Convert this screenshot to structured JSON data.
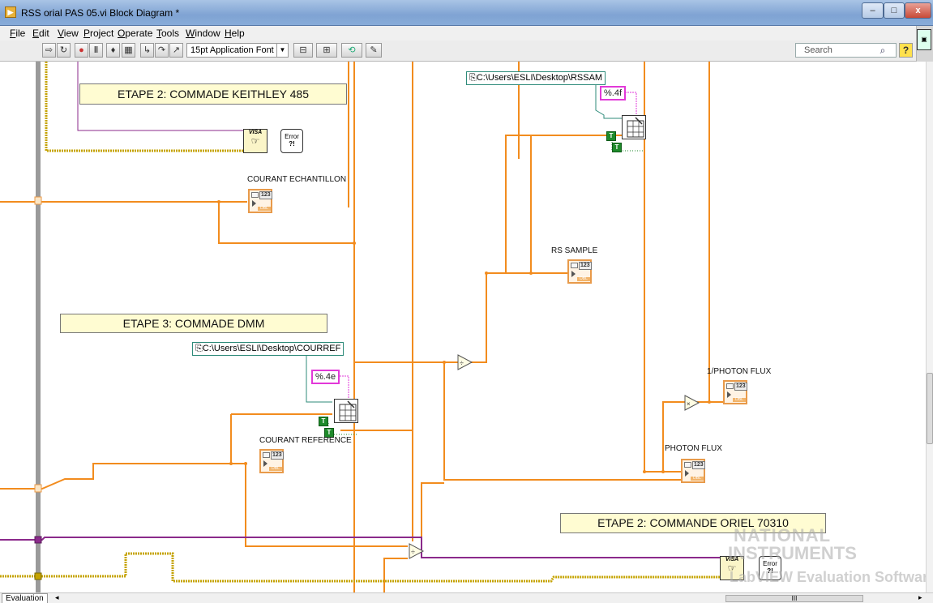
{
  "window": {
    "title": "RSS orial PAS 05.vi Block Diagram *",
    "buttons": {
      "minimize": "–",
      "maximize": "□",
      "close": "x"
    }
  },
  "menu": [
    "File",
    "Edit",
    "View",
    "Project",
    "Operate",
    "Tools",
    "Window",
    "Help"
  ],
  "toolbar": {
    "font": "15pt Application Font",
    "search_placeholder": "Search"
  },
  "diagram": {
    "banners": {
      "keithley": "ETAPE 2: COMMADE KEITHLEY 485",
      "dmm": "ETAPE 3: COMMADE  DMM",
      "oriel": "ETAPE 2: COMMANDE ORIEL 70310"
    },
    "labels": {
      "courant_echantillon": "COURANT ECHANTILLON",
      "rs_sample": "RS SAMPLE",
      "courant_reference": "COURANT REFERENCE",
      "photon_flux": "PHOTON FLUX",
      "inv_photon_flux": "1/PHOTON FLUX"
    },
    "path_constants": {
      "rssam": "C:\\Users\\ESLI\\Desktop\\RSSAM",
      "courref": "C:\\Users\\ESLI\\Desktop\\COURREF"
    },
    "format_constants": {
      "rssam_fmt": "%.4f",
      "courref_fmt": "%.4e"
    },
    "bool_true": "T",
    "indicator_num": "123",
    "indicator_tag": "DBL",
    "visa_label": "VISA",
    "error_label": "Error",
    "error_sub": "?!",
    "divide": "÷",
    "multiply": "×"
  },
  "watermark": {
    "line1": "NATIONAL",
    "line2": "INSTRUMENTS",
    "line3": "LabVIEW Evaluation Software"
  },
  "statusbar": {
    "tab": "Evaluation",
    "hscroll_grip": "III"
  },
  "colors": {
    "wire_dbl": "#f28c1e",
    "wire_error": "#c5a300",
    "wire_visa": "#8b2a8b",
    "wire_string": "#e238d8",
    "wire_path": "#2e8b7a",
    "banner_bg": "#fffcd2"
  }
}
